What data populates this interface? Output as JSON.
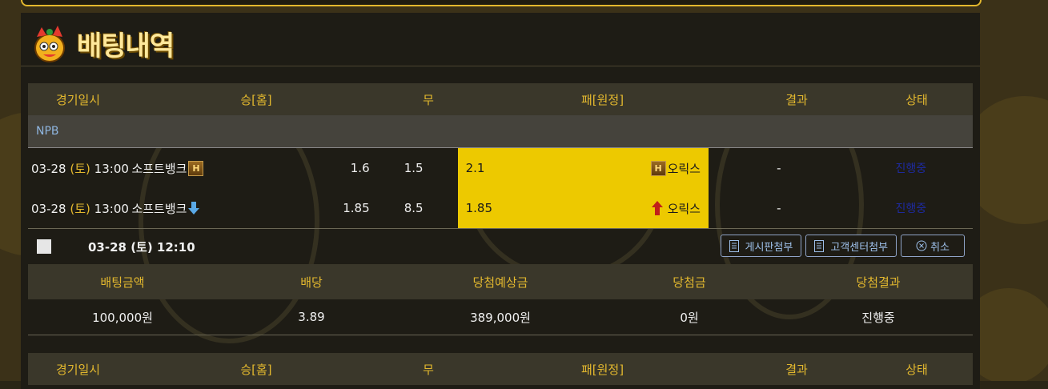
{
  "page_title": "배팅내역",
  "columns": {
    "date": "경기일시",
    "home": "승[홈]",
    "draw": "무",
    "away": "패[원정]",
    "result": "결과",
    "status": "상태"
  },
  "bet": {
    "league": "NPB",
    "games": [
      {
        "date": "03-28",
        "day": "(토)",
        "time": "13:00",
        "home_team": "소프트뱅크",
        "home_marker": "H",
        "home_odds": "1.6",
        "draw_odds": "1.5",
        "away_odds": "2.1",
        "away_marker": "H",
        "away_team": "오릭스",
        "result": "-",
        "status": "진행중"
      },
      {
        "date": "03-28",
        "day": "(토)",
        "time": "13:00",
        "home_team": "소프트뱅크",
        "home_marker": "down-arrow",
        "home_odds": "1.85",
        "draw_odds": "8.5",
        "away_odds": "1.85",
        "away_marker": "up-arrow",
        "away_team": "오릭스",
        "result": "-",
        "status": "진행중"
      }
    ],
    "bet_datetime": "03-28 (토) 12:10",
    "buttons": {
      "board_attach": "게시판첨부",
      "support_attach": "고객센터첨부",
      "cancel": "취소"
    },
    "summary_headers": [
      "배팅금액",
      "배당",
      "당첨예상금",
      "당첨금",
      "당첨결과"
    ],
    "summary_values": [
      "100,000원",
      "3.89",
      "389,000원",
      "0원",
      "진행중"
    ]
  },
  "colors": {
    "accent": "#e3b82e",
    "highlight": "#edc900",
    "background": "#1e1c15"
  }
}
